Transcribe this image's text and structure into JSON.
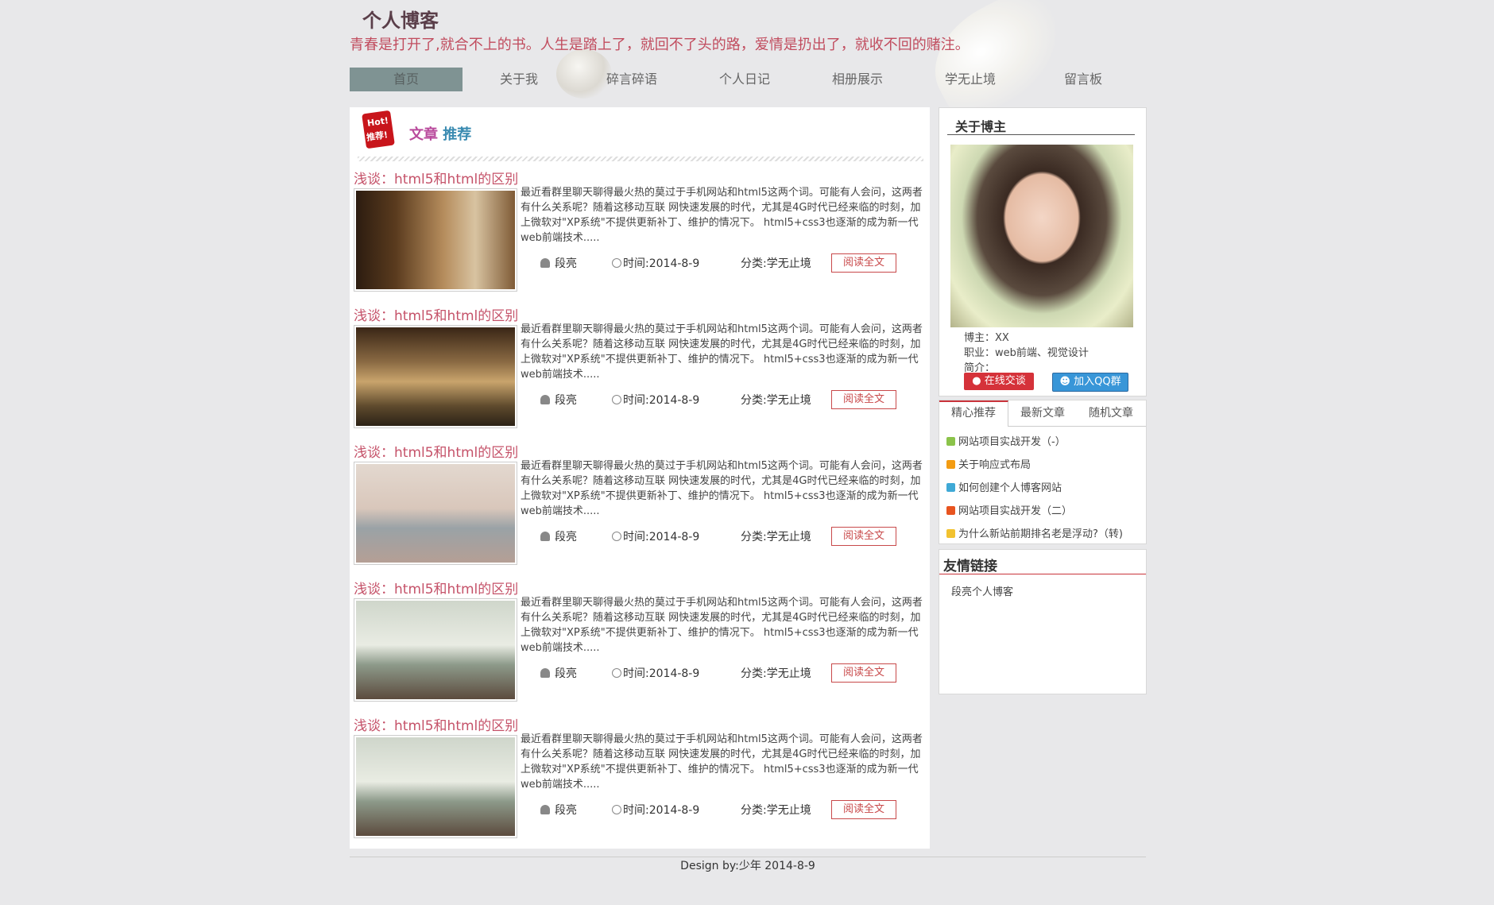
{
  "header": {
    "site_title": "个人博客",
    "slogan": "青春是打开了,就合不上的书。人生是踏上了，就回不了头的路，爱情是扔出了，就收不回的赌注。"
  },
  "nav": {
    "items": [
      {
        "label": "首页",
        "active": true
      },
      {
        "label": "关于我"
      },
      {
        "label": "碎言碎语"
      },
      {
        "label": "个人日记"
      },
      {
        "label": "相册展示"
      },
      {
        "label": "学无止境"
      },
      {
        "label": "留言板"
      }
    ]
  },
  "main": {
    "badge_line1": "Hot!",
    "badge_line2": "推荐!",
    "section_title_a": "文章",
    "section_title_b": "推荐",
    "articles": [
      {
        "title": "浅谈：html5和html的区别",
        "excerpt": "最近看群里聊天聊得最火热的莫过于手机网站和html5这两个词。可能有人会问，这两者有什么关系呢？随着这移动互联 网快速发展的时代，尤其是4G时代已经来临的时刻，加上微软对\"XP系统\"不提供更新补丁、维护的情况下。 html5+css3也逐渐的成为新一代web前端技术.....",
        "author": "段亮",
        "time": "时间:2014-8-9",
        "category": "分类:学无止境",
        "read_more": "阅读全文"
      },
      {
        "title": "浅谈：html5和html的区别",
        "excerpt": "最近看群里聊天聊得最火热的莫过于手机网站和html5这两个词。可能有人会问，这两者有什么关系呢？随着这移动互联 网快速发展的时代，尤其是4G时代已经来临的时刻，加上微软对\"XP系统\"不提供更新补丁、维护的情况下。 html5+css3也逐渐的成为新一代web前端技术.....",
        "author": "段亮",
        "time": "时间:2014-8-9",
        "category": "分类:学无止境",
        "read_more": "阅读全文"
      },
      {
        "title": "浅谈：html5和html的区别",
        "excerpt": "最近看群里聊天聊得最火热的莫过于手机网站和html5这两个词。可能有人会问，这两者有什么关系呢？随着这移动互联 网快速发展的时代，尤其是4G时代已经来临的时刻，加上微软对\"XP系统\"不提供更新补丁、维护的情况下。 html5+css3也逐渐的成为新一代web前端技术.....",
        "author": "段亮",
        "time": "时间:2014-8-9",
        "category": "分类:学无止境",
        "read_more": "阅读全文"
      },
      {
        "title": "浅谈：html5和html的区别",
        "excerpt": "最近看群里聊天聊得最火热的莫过于手机网站和html5这两个词。可能有人会问，这两者有什么关系呢？随着这移动互联 网快速发展的时代，尤其是4G时代已经来临的时刻，加上微软对\"XP系统\"不提供更新补丁、维护的情况下。 html5+css3也逐渐的成为新一代web前端技术.....",
        "author": "段亮",
        "time": "时间:2014-8-9",
        "category": "分类:学无止境",
        "read_more": "阅读全文"
      },
      {
        "title": "浅谈：html5和html的区别",
        "excerpt": "最近看群里聊天聊得最火热的莫过于手机网站和html5这两个词。可能有人会问，这两者有什么关系呢？随着这移动互联 网快速发展的时代，尤其是4G时代已经来临的时刻，加上微软对\"XP系统\"不提供更新补丁、维护的情况下。 html5+css3也逐渐的成为新一代web前端技术.....",
        "author": "段亮",
        "time": "时间:2014-8-9",
        "category": "分类:学无止境",
        "read_more": "阅读全文"
      }
    ]
  },
  "sidebar": {
    "about": {
      "title": "关于博主",
      "blogger": "博主：XX",
      "job": "职业：web前端、视觉设计",
      "intro": "简介：",
      "chat_button": "在线交谈",
      "qq_button": "加入QQ群"
    },
    "tabs": [
      {
        "label": "精心推荐",
        "active": true
      },
      {
        "label": "最新文章"
      },
      {
        "label": "随机文章"
      }
    ],
    "recommended": [
      {
        "label": "网站项目实战开发（-）",
        "color": "#8bc34a"
      },
      {
        "label": "关于响应式布局",
        "color": "#f39c12"
      },
      {
        "label": "如何创建个人博客网站",
        "color": "#3fa9d6"
      },
      {
        "label": "网站项目实战开发（二）",
        "color": "#e8541f"
      },
      {
        "label": "为什么新站前期排名老是浮动?（转)",
        "color": "#f2c230"
      }
    ],
    "links": {
      "title": "友情链接",
      "items": [
        "段亮个人博客"
      ]
    }
  },
  "footer": {
    "text": "Design by:少年 2014-8-9"
  }
}
